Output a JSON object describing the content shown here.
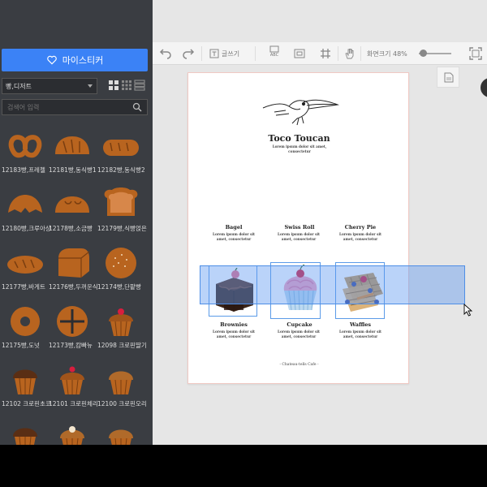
{
  "sidebar": {
    "my_sticker_label": "마이스티커",
    "category": "빵,디저트",
    "search_placeholder": "검색어 입력",
    "stickers": [
      {
        "label": "12183빵,프레첼",
        "shape": "pretzel"
      },
      {
        "label": "12181빵,동식빵1",
        "shape": "loaf-round"
      },
      {
        "label": "12182빵,동식빵2",
        "shape": "loaf-long"
      },
      {
        "label": "12180빵,크루아상",
        "shape": "croissant"
      },
      {
        "label": "12178빵,소금빵",
        "shape": "roll"
      },
      {
        "label": "12179빵,식빵얹은",
        "shape": "toast"
      },
      {
        "label": "12177빵,바게트",
        "shape": "baguette"
      },
      {
        "label": "12176빵,두꺼운식",
        "shape": "thick-loaf"
      },
      {
        "label": "12174빵,단팥빵",
        "shape": "bun"
      },
      {
        "label": "12175빵,도넛",
        "shape": "donut"
      },
      {
        "label": "12173빵,캄빠뉴",
        "shape": "campagne"
      },
      {
        "label": "12098 크로핀딸기",
        "shape": "muffin-berry"
      },
      {
        "label": "12102 크로핀초코",
        "shape": "muffin-choc"
      },
      {
        "label": "12101 크로핀체리",
        "shape": "muffin-cherry"
      },
      {
        "label": "12100 크로핀오리",
        "shape": "muffin-plain"
      },
      {
        "label": "",
        "shape": "muffin-choc"
      },
      {
        "label": "",
        "shape": "muffin-cream"
      },
      {
        "label": "",
        "shape": "muffin-plain"
      }
    ]
  },
  "toolbar": {
    "text_label": "글쓰기",
    "abc_label": "ABC",
    "zoom_label": "화면크기 48%",
    "zoom_value": 48
  },
  "page": {
    "title": "Toco Toucan",
    "lorem": "Lorem ipsum dolor sit amet, consectetur",
    "items_top": [
      "Bagel",
      "Swiss Roll",
      "Cherry Pie"
    ],
    "items_bottom": [
      "Brownies",
      "Cupcake",
      "Waffles"
    ],
    "footer": "- Chateau-tells Cafe -"
  },
  "colors": {
    "accent": "#3b82f6",
    "sidebar_bg": "#3a3d42",
    "bread": "#b8641f",
    "selection": "#5b9be8"
  }
}
